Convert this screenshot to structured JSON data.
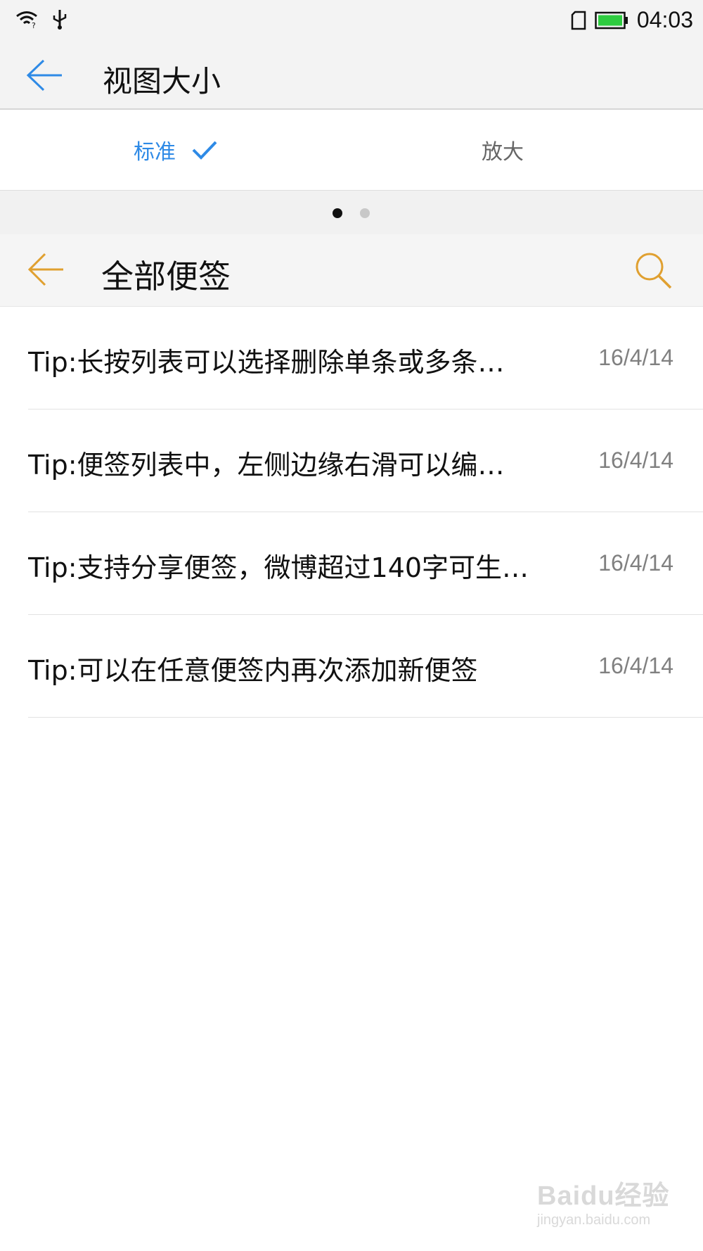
{
  "status_bar": {
    "time": "04:03",
    "icons": [
      "wifi-icon",
      "usb-icon",
      "sim-card-icon",
      "battery-icon"
    ],
    "battery_color": "#2ecc40"
  },
  "app_bar": {
    "title": "视图大小"
  },
  "tabs": {
    "standard_label": "标准",
    "zoom_label": "放大",
    "selected": "标准",
    "accent_color": "#2e8ae6"
  },
  "pager": {
    "pages": 2,
    "current": 1
  },
  "preview": {
    "title": "全部便签",
    "accent_color": "#e0a030",
    "notes": [
      {
        "text": "Tip:长按列表可以选择删除单条或多条…",
        "date": "16/4/14"
      },
      {
        "text": "Tip:便签列表中，左侧边缘右滑可以编…",
        "date": "16/4/14"
      },
      {
        "text": "Tip:支持分享便签，微博超过140字可生…",
        "date": "16/4/14"
      },
      {
        "text": "Tip:可以在任意便签内再次添加新便签",
        "date": "16/4/14"
      }
    ]
  },
  "watermark": {
    "brand": "Baidu经验",
    "url": "jingyan.baidu.com"
  }
}
